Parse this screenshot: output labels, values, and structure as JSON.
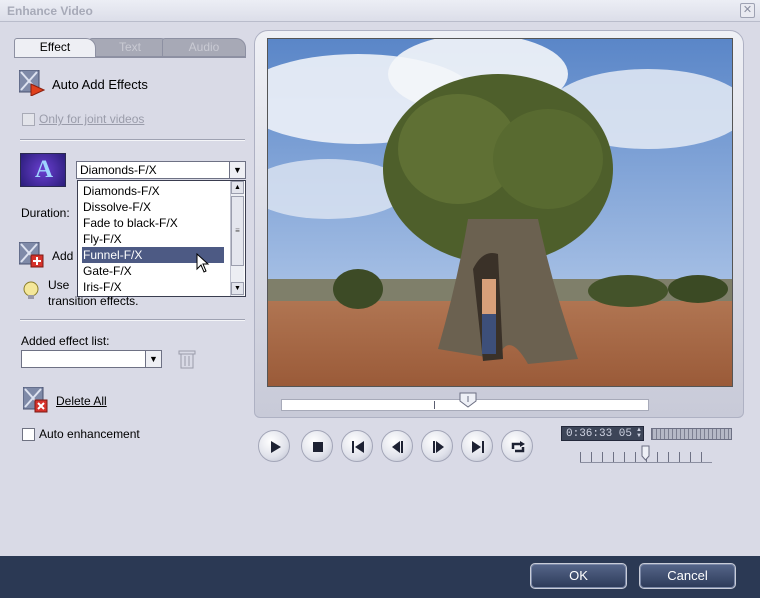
{
  "window": {
    "title": "Enhance Video",
    "close_glyph": "✕"
  },
  "tabs": [
    {
      "label": "Effect",
      "active": true
    },
    {
      "label": "Text",
      "active": false
    },
    {
      "label": "Audio",
      "active": false
    }
  ],
  "effect_panel": {
    "auto_add_effects_label": "Auto Add Effects",
    "only_joint_videos_label": "Only for joint videos",
    "selected_effect": "Diamonds-F/X",
    "effect_preview_letter": "A",
    "duration_label": "Duration:",
    "add_label": "Add",
    "tip_line1": "Use",
    "tip_line2": "transition effects.",
    "effect_options": [
      "Diamonds-F/X",
      "Dissolve-F/X",
      "Fade to black-F/X",
      "Fly-F/X",
      "Funnel-F/X",
      "Gate-F/X",
      "Iris-F/X"
    ],
    "highlighted_option_index": 4,
    "added_effect_list_label": "Added effect list:",
    "added_effect_value": "",
    "delete_all_label": "Delete All",
    "auto_enhancement_label": "Auto enhancement"
  },
  "player": {
    "timecode": "0:36:33 05",
    "controls": [
      "play-icon",
      "stop-icon",
      "skip-start-icon",
      "step-back-icon",
      "step-forward-icon",
      "skip-end-icon",
      "loop-icon"
    ]
  },
  "footer": {
    "ok_label": "OK",
    "cancel_label": "Cancel"
  },
  "colors": {
    "accent": "#2b3954",
    "selection": "#4d5a84",
    "panel": "#d9dae6"
  }
}
